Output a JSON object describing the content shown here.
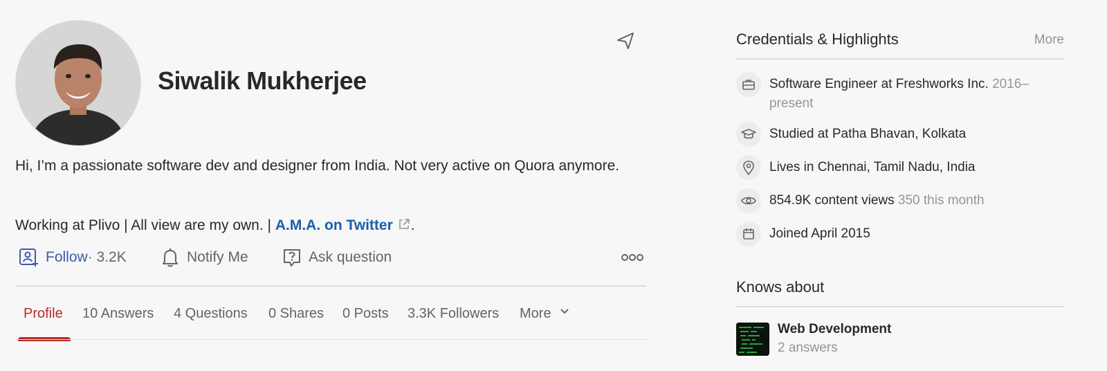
{
  "profile": {
    "name": "Siwalik Mukherjee",
    "bio_line1": "Hi, I’m a passionate software dev and designer from India. Not very active on Quora anymore.",
    "bio_line2_prefix": "Working at Plivo | All view are my own. | ",
    "bio_link": "A.M.A. on Twitter",
    "bio_line2_suffix": "."
  },
  "actions": {
    "follow_label": "Follow",
    "follow_count": " · 3.2K",
    "notify_label": "Notify Me",
    "ask_label": "Ask question"
  },
  "tabs": [
    {
      "label": "Profile",
      "active": true
    },
    {
      "label": "10 Answers"
    },
    {
      "label": "4 Questions"
    },
    {
      "label": "0 Shares"
    },
    {
      "label": "0 Posts"
    },
    {
      "label": "3.3K Followers"
    },
    {
      "label": "More"
    }
  ],
  "credentials": {
    "title": "Credentials & Highlights",
    "more": "More",
    "items": [
      {
        "icon": "briefcase-icon",
        "text": "Software Engineer at Freshworks Inc.",
        "muted": "2016–present"
      },
      {
        "icon": "graduation-cap-icon",
        "text": "Studied at Patha Bhavan, Kolkata"
      },
      {
        "icon": "location-pin-icon",
        "text": "Lives in Chennai, Tamil Nadu, India"
      },
      {
        "icon": "eye-icon",
        "text": "854.9K content views",
        "muted": "350 this month"
      },
      {
        "icon": "calendar-icon",
        "text": "Joined April 2015"
      }
    ]
  },
  "knows_about": {
    "title": "Knows about",
    "topics": [
      {
        "name": "Web Development",
        "sub": "2 answers"
      }
    ]
  },
  "colors": {
    "brand_red": "#b92b27",
    "link_blue": "#195faa",
    "follow_blue": "#3f5aa9"
  }
}
